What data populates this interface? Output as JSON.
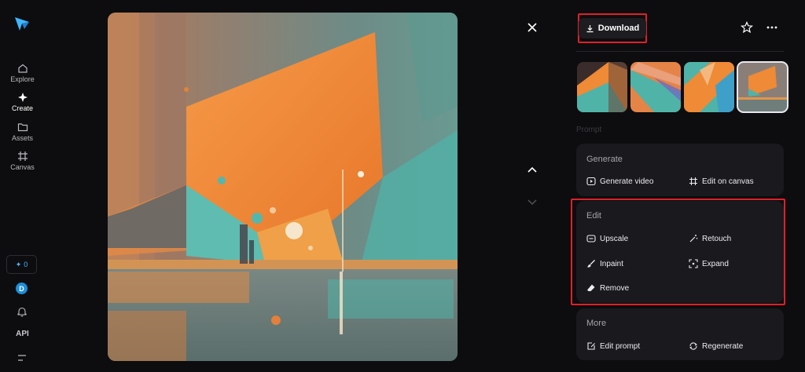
{
  "nav": {
    "items": [
      {
        "label": "Explore",
        "icon": "home-icon"
      },
      {
        "label": "Create",
        "icon": "sparkle-icon"
      },
      {
        "label": "Assets",
        "icon": "folder-icon"
      },
      {
        "label": "Canvas",
        "icon": "frame-icon"
      }
    ],
    "credits": "0",
    "avatar_initial": "D",
    "api_label": "API"
  },
  "toolbar": {
    "download_label": "Download"
  },
  "faded_label": "Prompt",
  "sections": {
    "generate": {
      "title": "Generate",
      "actions": [
        {
          "label": "Generate video",
          "icon": "play-square-icon"
        },
        {
          "label": "Edit on canvas",
          "icon": "frame-icon"
        }
      ]
    },
    "edit": {
      "title": "Edit",
      "actions": [
        {
          "label": "Upscale",
          "icon": "upscale-icon"
        },
        {
          "label": "Retouch",
          "icon": "magic-wand-icon"
        },
        {
          "label": "Inpaint",
          "icon": "brush-icon"
        },
        {
          "label": "Expand",
          "icon": "expand-icon"
        },
        {
          "label": "Remove",
          "icon": "eraser-icon"
        }
      ]
    },
    "more": {
      "title": "More",
      "actions": [
        {
          "label": "Edit prompt",
          "icon": "edit-prompt-icon"
        },
        {
          "label": "Regenerate",
          "icon": "refresh-icon"
        }
      ]
    }
  },
  "colors": {
    "accent_blue": "#1d8fd8",
    "highlight_red": "#e0202a",
    "orange": "#f08a34",
    "teal": "#4fb3a8"
  }
}
